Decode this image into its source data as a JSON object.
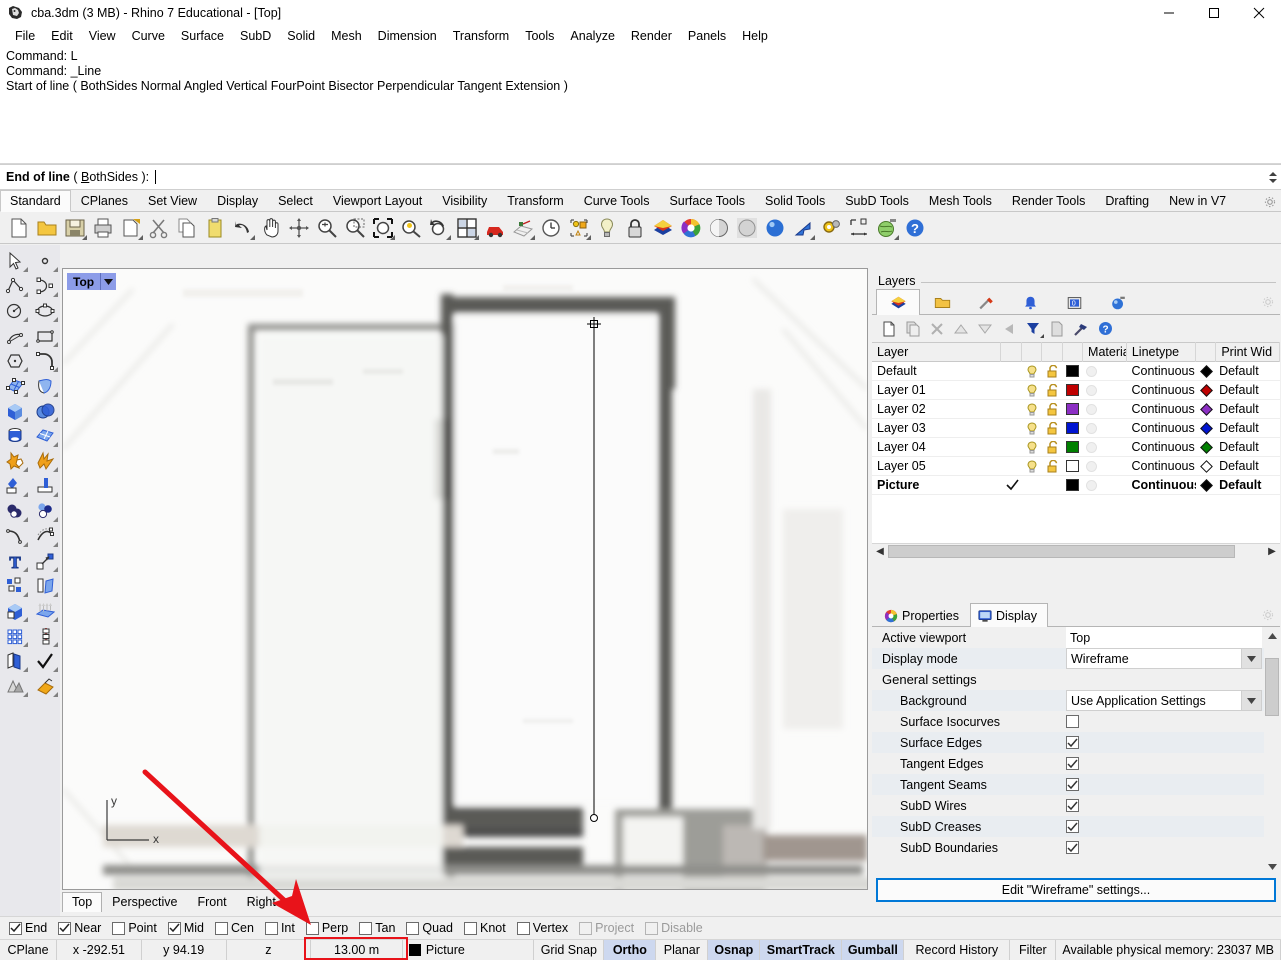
{
  "window": {
    "title": "cba.3dm (3 MB) - Rhino 7 Educational - [Top]",
    "minimize_label": "Minimize",
    "maximize_label": "Maximize",
    "close_label": "Close"
  },
  "menu": {
    "items": [
      "File",
      "Edit",
      "View",
      "Curve",
      "Surface",
      "SubD",
      "Solid",
      "Mesh",
      "Dimension",
      "Transform",
      "Tools",
      "Analyze",
      "Render",
      "Panels",
      "Help"
    ]
  },
  "command_history": {
    "lines": [
      "Command: L",
      "Command: _Line",
      "Start of line ( BothSides  Normal  Angled  Vertical  FourPoint  Bisector  Perpendicular  Tangent  Extension )"
    ]
  },
  "command_prompt": {
    "label_bold": "End of line",
    "label_options": "( BothSides ):",
    "option_underlined": "B",
    "input_value": ""
  },
  "toolbar_tabs": {
    "items": [
      "Standard",
      "CPlanes",
      "Set View",
      "Display",
      "Select",
      "Viewport Layout",
      "Visibility",
      "Transform",
      "Curve Tools",
      "Surface Tools",
      "Solid Tools",
      "SubD Tools",
      "Mesh Tools",
      "Render Tools",
      "Drafting",
      "New in V7"
    ],
    "active": "Standard",
    "options_icon": "gear-icon"
  },
  "main_toolbar": {
    "icons": [
      "new-file-icon",
      "open-folder-icon",
      "save-icon",
      "print-icon",
      "copy-to-clipboard-icon",
      "cut-scissors-icon",
      "copy-icon",
      "paste-icon",
      "undo-arrow-icon",
      "pan-hand-icon",
      "rotate-view-icon",
      "zoom-in-out-icon",
      "zoom-window-icon",
      "zoom-extents-icon",
      "zoom-selected-icon",
      "zoom-previous-icon",
      "four-viewport-icon",
      "render-preview-car-icon",
      "cplane-grid-icon",
      "clock-icon",
      "object-properties-icon",
      "light-bulb-icon",
      "lock-icon",
      "layers-icon",
      "color-wheel-icon",
      "shaded-sphere-icon",
      "ghosted-sphere-icon",
      "rendered-sphere-icon",
      "arrow-cursor-icon",
      "options-gears-icon",
      "dimension-icon",
      "render-globe-icon",
      "help-icon"
    ]
  },
  "left_toolbar": {
    "icons": [
      [
        "select-arrow-icon",
        "point-icon"
      ],
      [
        "polyline-icon",
        "control-point-curve-icon"
      ],
      [
        "circle-icon",
        "ellipse-icon"
      ],
      [
        "arc-icon",
        "rectangle-icon"
      ],
      [
        "polygon-icon",
        "curve-fillet-icon"
      ],
      [
        "surface-from-points-icon",
        "extrude-surface-icon"
      ],
      [
        "box-icon",
        "sphere-boolean-icon"
      ],
      [
        "cylinder-icon",
        "surface-patch-icon"
      ],
      [
        "boolean-union-icon",
        "explode-icon"
      ],
      [
        "trim-icon",
        "split-icon"
      ],
      [
        "boolean-difference-icon",
        "boolean-intersection-icon"
      ],
      [
        "fillet-curve-icon",
        "blend-curve-icon"
      ],
      [
        "text-icon",
        "leader-dimension-icon"
      ],
      [
        "group-objects-icon",
        "mirror-icon"
      ],
      [
        "extrude-solid-icon",
        "extrude-normal-icon"
      ],
      [
        "array-icon",
        "array-along-curve-icon"
      ],
      [
        "copy-objects-icon",
        "check-objects-icon"
      ],
      [
        "mesh-from-surface-icon",
        "render-material-icon"
      ]
    ]
  },
  "viewport": {
    "title": "Top",
    "dropdown_icon": "chevron-down-icon",
    "axis_x_label": "x",
    "axis_y_label": "y",
    "background_description": "blurred architectural floor plan picture",
    "line": {
      "start_point_icon": "crosshair-point-icon",
      "end_point_icon": "control-point-icon"
    }
  },
  "viewport_tabs": {
    "items": [
      "Top",
      "Perspective",
      "Front",
      "Right"
    ],
    "active": "Top"
  },
  "layers_panel": {
    "caption": "Layers",
    "tabs": [
      "layers-icon",
      "folder-blocks-icon",
      "display-pen-icon",
      "notification-bell-icon",
      "named-views-icon",
      "render-globe-icon"
    ],
    "active_tab_index": 0,
    "options_icon": "gear-icon",
    "toolbar_icons": [
      "new-layer-icon",
      "copy-layer-icon",
      "delete-layer-icon",
      "move-up-icon",
      "move-down-icon",
      "move-left-icon",
      "filter-icon",
      "new-sublayer-icon",
      "layer-tools-icon",
      "help-icon"
    ],
    "columns": [
      "Layer",
      "",
      "",
      "",
      "",
      "Material",
      "Linetype",
      "",
      "Print Wid"
    ],
    "rows": [
      {
        "name": "Default",
        "current": false,
        "on": true,
        "locked": false,
        "color": "#000000",
        "linetype": "Continuous",
        "print_color": "#000000",
        "print_width": "Default",
        "bold": false
      },
      {
        "name": "Layer 01",
        "current": false,
        "on": true,
        "locked": false,
        "color": "#c00000",
        "linetype": "Continuous",
        "print_color": "#c00000",
        "print_width": "Default",
        "bold": false
      },
      {
        "name": "Layer 02",
        "current": false,
        "on": true,
        "locked": false,
        "color": "#8c2fc4",
        "linetype": "Continuous",
        "print_color": "#8c2fc4",
        "print_width": "Default",
        "bold": false
      },
      {
        "name": "Layer 03",
        "current": false,
        "on": true,
        "locked": false,
        "color": "#0014d2",
        "linetype": "Continuous",
        "print_color": "#0014d2",
        "print_width": "Default",
        "bold": false
      },
      {
        "name": "Layer 04",
        "current": false,
        "on": true,
        "locked": false,
        "color": "#008000",
        "linetype": "Continuous",
        "print_color": "#008000",
        "print_width": "Default",
        "bold": false
      },
      {
        "name": "Layer 05",
        "current": false,
        "on": true,
        "locked": false,
        "color": "#ffffff",
        "linetype": "Continuous",
        "print_color": "#ffffff",
        "print_width": "Default",
        "bold": false
      },
      {
        "name": "Picture",
        "current": true,
        "on": null,
        "locked": null,
        "color": "#000000",
        "linetype": "Continuous",
        "print_color": "#000000",
        "print_width": "Default",
        "bold": true
      }
    ],
    "scroll_left_icon": "chevron-left-icon",
    "scroll_right_icon": "chevron-right-icon"
  },
  "display_panel": {
    "tabs": [
      {
        "label": "Properties",
        "icon": "color-wheel-icon",
        "active": false
      },
      {
        "label": "Display",
        "icon": "monitor-icon",
        "active": true
      }
    ],
    "options_icon": "gear-icon",
    "rows": [
      {
        "label": "Active viewport",
        "type": "text",
        "value": "Top",
        "indent": false
      },
      {
        "label": "Display mode",
        "type": "combo",
        "value": "Wireframe",
        "indent": false
      },
      {
        "label": "General settings",
        "type": "section",
        "value": "",
        "indent": false
      },
      {
        "label": "Background",
        "type": "combo",
        "value": "Use Application Settings",
        "indent": true
      },
      {
        "label": "Surface Isocurves",
        "type": "checkbox",
        "value": false,
        "indent": true
      },
      {
        "label": "Surface Edges",
        "type": "checkbox",
        "value": true,
        "indent": true
      },
      {
        "label": "Tangent Edges",
        "type": "checkbox",
        "value": true,
        "indent": true
      },
      {
        "label": "Tangent Seams",
        "type": "checkbox",
        "value": true,
        "indent": true
      },
      {
        "label": "SubD Wires",
        "type": "checkbox",
        "value": true,
        "indent": true
      },
      {
        "label": "SubD Creases",
        "type": "checkbox",
        "value": true,
        "indent": true
      },
      {
        "label": "SubD Boundaries",
        "type": "checkbox",
        "value": true,
        "indent": true
      }
    ],
    "edit_button_label": "Edit \"Wireframe\" settings...",
    "scroll_up_icon": "chevron-up-icon",
    "scroll_down_icon": "chevron-down-icon"
  },
  "osnap_bar": {
    "items": [
      {
        "label": "End",
        "checked": true,
        "disabled": false
      },
      {
        "label": "Near",
        "checked": true,
        "disabled": false
      },
      {
        "label": "Point",
        "checked": false,
        "disabled": false
      },
      {
        "label": "Mid",
        "checked": true,
        "disabled": false
      },
      {
        "label": "Cen",
        "checked": false,
        "disabled": false
      },
      {
        "label": "Int",
        "checked": false,
        "disabled": false
      },
      {
        "label": "Perp",
        "checked": false,
        "disabled": false
      },
      {
        "label": "Tan",
        "checked": false,
        "disabled": false
      },
      {
        "label": "Quad",
        "checked": false,
        "disabled": false
      },
      {
        "label": "Knot",
        "checked": false,
        "disabled": false
      },
      {
        "label": "Vertex",
        "checked": false,
        "disabled": false
      },
      {
        "label": "Project",
        "checked": false,
        "disabled": true
      },
      {
        "label": "Disable",
        "checked": false,
        "disabled": true
      }
    ]
  },
  "status_bar": {
    "cplane_label": "CPlane",
    "x_value": "x -292.51",
    "y_value": "y 94.19",
    "z_value": "z",
    "distance_value": "13.00 m",
    "layer_label": "Picture",
    "layer_color": "#000000",
    "toggles": [
      {
        "label": "Grid Snap",
        "on": false
      },
      {
        "label": "Ortho",
        "on": true
      },
      {
        "label": "Planar",
        "on": false
      },
      {
        "label": "Osnap",
        "on": true
      },
      {
        "label": "SmartTrack",
        "on": true
      },
      {
        "label": "Gumball",
        "on": true
      },
      {
        "label": "Record History",
        "on": false
      },
      {
        "label": "Filter",
        "on": false
      }
    ],
    "memory_text": "Available physical memory: 23037 MB"
  },
  "annotation": {
    "arrow_color": "#e8131a",
    "highlight_color": "#e8131a",
    "highlight_target": "distance_field"
  }
}
